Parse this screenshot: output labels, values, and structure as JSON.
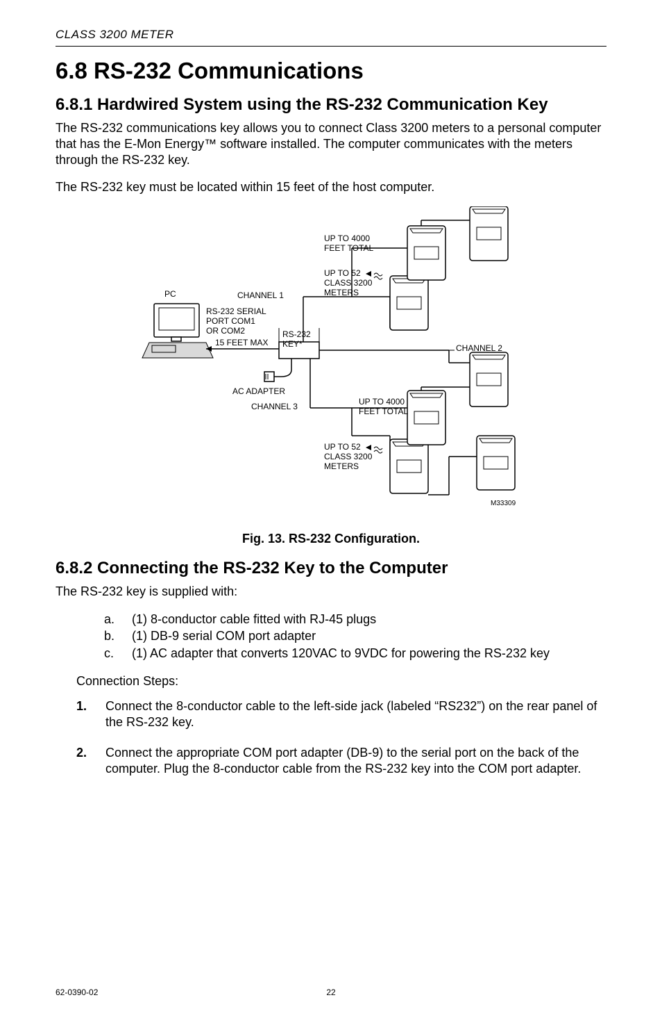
{
  "running_head": "CLASS 3200 METER",
  "h1": "6.8 RS-232 Communications",
  "h2_1": "6.8.1 Hardwired System using the RS-232 Communication Key",
  "p1": "The RS-232 communications key allows you to connect Class 3200 meters to a personal computer that has the E-Mon Energy™ software installed. The computer communicates with the meters through the RS-232 key.",
  "p2": "The RS-232 key must be located within 15 feet of the host computer.",
  "fig": {
    "labels": {
      "pc": "PC",
      "rs232_serial": "RS-232 SERIAL\nPORT COM1\nOR COM2",
      "fifteen_feet": "15 FEET MAX",
      "rs232_key": "RS-232\nKEY*",
      "ac_adapter": "AC ADAPTER",
      "channel1": "CHANNEL 1",
      "channel2": "CHANNEL 2",
      "channel3": "CHANNEL 3",
      "up_to_4000_a": "UP TO 4000\nFEET TOTAL",
      "up_to_4000_b": "UP TO 4000\nFEET TOTAL",
      "up_to_52_a": "UP TO 52\nCLASS 3200\nMETERS",
      "up_to_52_b": "UP TO 52\nCLASS 3200\nMETERS",
      "ref": "M33309"
    },
    "caption": "Fig. 13. RS-232 Configuration."
  },
  "h2_2": "6.8.2 Connecting the RS-232 Key to the Computer",
  "p3": "The RS-232 key is supplied with:",
  "supplied": [
    {
      "m": "a.",
      "t": "(1) 8-conductor cable fitted with RJ-45 plugs"
    },
    {
      "m": "b.",
      "t": "(1) DB-9 serial COM port adapter"
    },
    {
      "m": "c.",
      "t": "(1) AC adapter that converts 120VAC to 9VDC for powering the RS-232 key"
    }
  ],
  "conn_steps_label": "Connection Steps:",
  "steps": [
    {
      "n": "1.",
      "t": "Connect the 8-conductor cable to the left-side jack (labeled “RS232”) on the rear panel of the RS-232 key."
    },
    {
      "n": "2.",
      "t": "Connect the appropriate COM port adapter (DB-9) to the serial port on the back of the computer. Plug the 8-conductor cable from the RS-232 key into the COM port adapter."
    }
  ],
  "footer": {
    "doc": "62-0390-02",
    "page": "22"
  }
}
